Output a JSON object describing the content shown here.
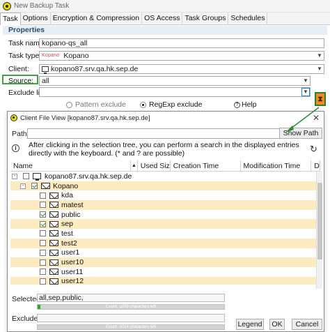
{
  "window": {
    "title": "New Backup Task"
  },
  "tabs": [
    "Task",
    "Options",
    "Encryption & Compression",
    "OS Access",
    "Task Groups",
    "Schedules"
  ],
  "properties": {
    "heading": "Properties",
    "task_name_label": "Task name:",
    "task_name_value": "kopano-qs_all",
    "task_type_label": "Task type:",
    "task_type_icon_text": "Kopano",
    "task_type_value": "Kopano",
    "client_label": "Client:",
    "client_value": "kopano87.srv.qa.hk.sep.de",
    "source_label": "Source:",
    "source_value": "all",
    "exclude_label": "Exclude list:",
    "exclude_value": "",
    "pattern_exclude_label": "Pattern exclude",
    "regexp_exclude_label": "RegExp exclude",
    "help_label": "Help",
    "highlight_color": "#43a047",
    "source_button_color": "#f08a23"
  },
  "dialog": {
    "title": "Client File View [kopano87.srv.qa.hk.sep.de]",
    "path_label": "Path:",
    "path_value": "",
    "show_path_label": "Show Path",
    "info_text": "After clicking in the selection tree, you can perform a search in the displayed entries directly with the keyboard. (* and ? are possible)",
    "columns": [
      "Name",
      "Used Size",
      "Creation Time",
      "Modification Time",
      "D"
    ],
    "tree": [
      {
        "label": "kopano87.srv.qa.hk.sep.de",
        "level": 0,
        "type": "computer",
        "check": "none",
        "toggle": "-",
        "highlight": false
      },
      {
        "label": "Kopano",
        "level": 1,
        "type": "mail",
        "check": "checked",
        "toggle": "-",
        "highlight": true
      },
      {
        "label": "kda",
        "level": 2,
        "type": "mail",
        "check": "none",
        "highlight": false
      },
      {
        "label": "matest",
        "level": 2,
        "type": "mail",
        "check": "none",
        "highlight": true
      },
      {
        "label": "public",
        "level": 2,
        "type": "mail",
        "check": "checked",
        "highlight": false
      },
      {
        "label": "sep",
        "level": 2,
        "type": "mail",
        "check": "checked",
        "highlight": true
      },
      {
        "label": "test",
        "level": 2,
        "type": "mail",
        "check": "none",
        "highlight": false
      },
      {
        "label": "test2",
        "level": 2,
        "type": "mail",
        "check": "none",
        "highlight": true
      },
      {
        "label": "user1",
        "level": 2,
        "type": "mail",
        "check": "none",
        "highlight": false
      },
      {
        "label": "user10",
        "level": 2,
        "type": "mail",
        "check": "none",
        "highlight": true
      },
      {
        "label": "user11",
        "level": 2,
        "type": "mail",
        "check": "none",
        "highlight": false
      },
      {
        "label": "user12",
        "level": 2,
        "type": "mail",
        "check": "none",
        "highlight": true
      }
    ],
    "selected_label": "Selected:",
    "selected_value": "all,sep,public,",
    "selected_count_text": "Count: 1009 characters left",
    "selected_fill": 0.015,
    "excluded_label": "Excluded:",
    "excluded_value": "",
    "excluded_count_text": "Count: 1024 characters left",
    "excluded_fill": 0,
    "buttons": {
      "legend": "Legend",
      "ok": "OK",
      "cancel": "Cancel"
    },
    "highlight_row_color": "#fcebc0",
    "count_fill_color": "#2fa532"
  }
}
